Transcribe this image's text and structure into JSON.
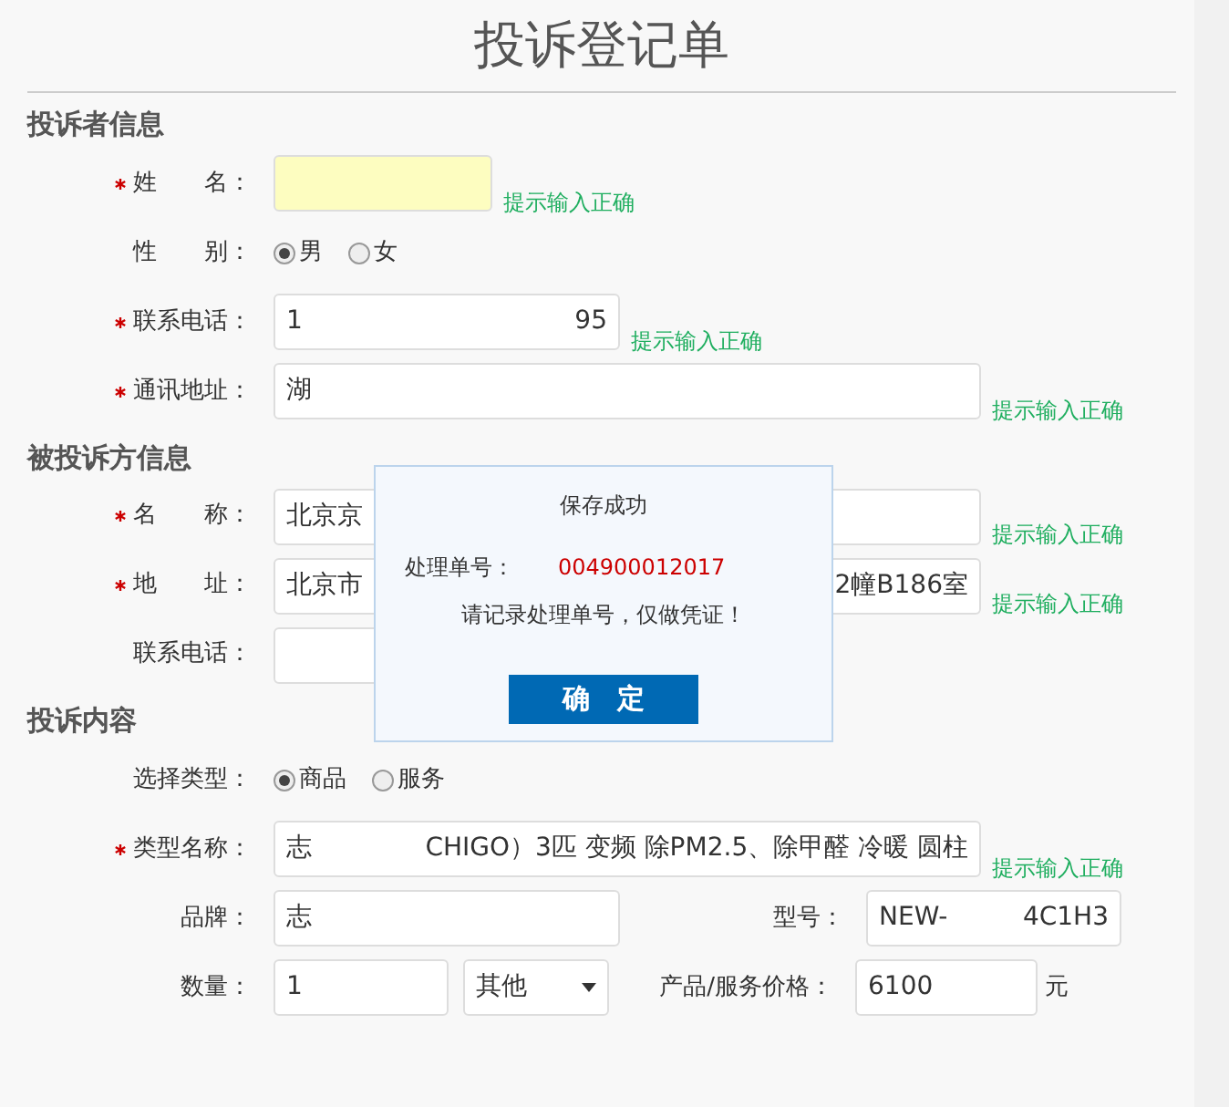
{
  "title": "投诉登记单",
  "sections": [
    {
      "title": "投诉者信息",
      "fields": [
        {
          "kind": "text",
          "label": "姓　　名：",
          "required": true,
          "highlighted": true,
          "hint": "提示输入正确"
        },
        {
          "kind": "radio",
          "label": "性　　别：",
          "required": false,
          "options": [
            {
              "label": "男",
              "selected": true
            },
            {
              "label": "女",
              "selected": false
            }
          ]
        },
        {
          "kind": "text",
          "label": "联系电话：",
          "required": true,
          "highlighted": false,
          "values": [
            "1",
            "95"
          ],
          "hint": "提示输入正确"
        },
        {
          "kind": "long",
          "label": "通讯地址：",
          "required": true,
          "values": [
            "湖"
          ],
          "hint": "提示输入正确"
        }
      ]
    },
    {
      "title": "被投诉方信息",
      "fields": [
        {
          "kind": "long",
          "label": "名　　称：",
          "required": true,
          "values": [
            "北京京"
          ],
          "hint": "提示输入正确"
        },
        {
          "kind": "long",
          "label": "地　　址：",
          "required": true,
          "values": [
            "北京市",
            "2幢B186室"
          ],
          "hint": "提示输入正确"
        },
        {
          "kind": "text",
          "label": "联系电话：",
          "required": false,
          "highlighted": false
        }
      ]
    },
    {
      "title": "投诉内容",
      "fields": [
        {
          "kind": "radio",
          "label": "选择类型：",
          "required": false,
          "options": [
            {
              "label": "商品",
              "selected": true
            },
            {
              "label": "服务",
              "selected": false
            }
          ]
        },
        {
          "kind": "long",
          "label": "类型名称：",
          "required": true,
          "values": [
            "志",
            "CHIGO）3匹 变频 除PM2.5、除甲醛 冷暖 圆柱"
          ],
          "hint": "提示输入正确"
        },
        {
          "kind": "pair",
          "label": "品牌：",
          "required": false,
          "values": [
            "志"
          ],
          "label2": "型号：",
          "values2": [
            "NEW-",
            "4C1H3"
          ]
        },
        {
          "kind": "quantity",
          "label": "数量：",
          "required": false,
          "values": [
            "1"
          ],
          "unit_select": "其他",
          "label2": "产品/服务价格：",
          "values2": [
            "6100"
          ],
          "suffix": "元"
        }
      ]
    }
  ],
  "dialog": {
    "title": "保存成功",
    "number_label": "处理单号：",
    "number": "004900012017",
    "message": "请记录处理单号，仅做凭证！",
    "button": "确　定"
  }
}
